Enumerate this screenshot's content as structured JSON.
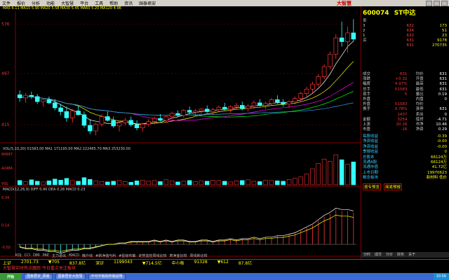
{
  "menu": {
    "items": [
      "文件",
      "报价",
      "分析",
      "功能",
      "大智慧",
      "平台",
      "工具",
      "帮助",
      "资讯",
      "国泰君安"
    ],
    "brand": "大智慧"
  },
  "info_bar": {
    "ma_line": "MA5 6.11 MA10 5.90 MA20 5.58 MA30 5.45 MA60 5.20 MA120 4.96"
  },
  "price_axis": {
    "labels": [
      "576",
      "497",
      "415"
    ]
  },
  "volume_axis": {
    "labels": [
      "84997",
      "42484",
      "VOL"
    ]
  },
  "macd_axis": {
    "labels": [
      "0.34",
      "0.14",
      "-0.02"
    ]
  },
  "vol_header": "VOL(5,10,20) 51583.00 MA1 171195.00 MA2 222465.70 MA3 253230.00",
  "macd_header": "MACD(12,26,9) DIFF 0.40 DEA 0.28 MACD 0.23",
  "indicator_tabs": [
    "KDJ",
    "CCI",
    "DMI",
    "PAE",
    "主力进出",
    "MACD",
    "散户线",
    "#新净值与利",
    "#星级布策",
    "走势监控周线比较",
    "寿净室比较",
    "周线新比较"
  ],
  "right_panel": {
    "code": "600074",
    "name": "ST中达",
    "orderbook": [
      {
        "label": "卖",
        "price": "",
        "vol": ""
      },
      {
        "label": "3",
        "price": "632",
        "vol": "173"
      },
      {
        "label": "2",
        "price": "634",
        "vol": "51"
      },
      {
        "label": "1",
        "price": "632",
        "vol": "23"
      },
      {
        "label": "买",
        "price": "631",
        "vol": "9178"
      },
      {
        "label": "",
        "price": "631",
        "vol": "270735"
      }
    ],
    "stats": [
      {
        "a": "成交",
        "av": "631",
        "b": "均价",
        "bv": "631"
      },
      {
        "a": "涨跌",
        "av": "+0.32",
        "b": "开盘",
        "bv": "631"
      },
      {
        "a": "幅度",
        "av": "4.97%",
        "b": "最高",
        "bv": "631"
      },
      {
        "a": "总手",
        "av": "51583",
        "b": "最低",
        "bv": "631"
      },
      {
        "a": "现手",
        "av": "5",
        "b": "量比",
        "bv": "0.19"
      },
      {
        "a": "外盘",
        "av": "",
        "b": "内盘",
        "bv": "0"
      },
      {
        "a": "外盘",
        "av": "51583",
        "b": "均价",
        "bv": ""
      },
      {
        "a": "换手",
        "av": "0.78%",
        "b": "涨停",
        "bv": "631"
      },
      {
        "a": "",
        "av": "1437",
        "b": "卖出",
        "bv": "0"
      },
      {
        "a": "金额",
        "av": "3254",
        "b": "借贷",
        "bv": "-4.71"
      },
      {
        "a": "上涨",
        "av": "20.16",
        "b": "市净",
        "bv": "10.46"
      },
      {
        "a": "市盈",
        "av": "-16",
        "b": "净资",
        "bv": "0.29"
      }
    ],
    "fin": [
      {
        "k": "每股收益",
        "v": "-0.39"
      },
      {
        "k": "净资收益",
        "v": "-0.00"
      },
      {
        "k": "净资收益",
        "v": "-0.00"
      },
      {
        "k": "季报收益",
        "v": "0"
      },
      {
        "k": "总股本",
        "v": "66124万"
      },
      {
        "k": "流通A股",
        "v": "66124万"
      },
      {
        "k": "流通市值",
        "v": "41.72亿"
      },
      {
        "k": "上市日期",
        "v": "19970623"
      },
      {
        "k": "概念板块",
        "v": "新材料   低价"
      }
    ],
    "links": [
      "按专预览",
      "简易预报"
    ],
    "bottom_tabs": [
      "分时",
      "成交",
      "分价",
      "财务",
      "关于"
    ]
  },
  "index_bar": {
    "row1": [
      "上证",
      "2701.73",
      "▼705",
      "837.8亿",
      "深证",
      "1199043",
      "▼714.5亿",
      "中小板",
      "91328",
      "▼612",
      "87.8亿"
    ],
    "row2": "大智慧实时热点跟踪 今日重点关注板块",
    "row3": [
      "270173",
      "▼705",
      "837.8亿"
    ]
  },
  "taskbar": {
    "start": "开始",
    "tasks": [
      "国泰君安_原版",
      "国泰君安大智慧",
      "不可不知的终端说明"
    ],
    "clock": "10:56"
  },
  "chart_data": {
    "type": "candlestick",
    "y_ticks": [
      576,
      497,
      415
    ],
    "candles": [
      {
        "o": 463,
        "h": 470,
        "l": 452,
        "c": 458
      },
      {
        "o": 458,
        "h": 466,
        "l": 450,
        "c": 462
      },
      {
        "o": 462,
        "h": 468,
        "l": 456,
        "c": 460
      },
      {
        "o": 460,
        "h": 464,
        "l": 448,
        "c": 452
      },
      {
        "o": 452,
        "h": 458,
        "l": 444,
        "c": 455
      },
      {
        "o": 455,
        "h": 460,
        "l": 448,
        "c": 450
      },
      {
        "o": 450,
        "h": 456,
        "l": 438,
        "c": 442
      },
      {
        "o": 442,
        "h": 448,
        "l": 430,
        "c": 436
      },
      {
        "o": 436,
        "h": 444,
        "l": 420,
        "c": 426
      },
      {
        "o": 426,
        "h": 440,
        "l": 418,
        "c": 437
      },
      {
        "o": 437,
        "h": 445,
        "l": 430,
        "c": 431
      },
      {
        "o": 431,
        "h": 436,
        "l": 410,
        "c": 414
      },
      {
        "o": 414,
        "h": 424,
        "l": 400,
        "c": 405
      },
      {
        "o": 405,
        "h": 418,
        "l": 398,
        "c": 416
      },
      {
        "o": 416,
        "h": 432,
        "l": 412,
        "c": 428
      },
      {
        "o": 428,
        "h": 436,
        "l": 420,
        "c": 422
      },
      {
        "o": 422,
        "h": 428,
        "l": 410,
        "c": 413
      },
      {
        "o": 413,
        "h": 420,
        "l": 404,
        "c": 418
      },
      {
        "o": 418,
        "h": 426,
        "l": 414,
        "c": 422
      },
      {
        "o": 422,
        "h": 428,
        "l": 412,
        "c": 415
      },
      {
        "o": 415,
        "h": 422,
        "l": 406,
        "c": 410
      },
      {
        "o": 410,
        "h": 418,
        "l": 404,
        "c": 416
      },
      {
        "o": 416,
        "h": 424,
        "l": 412,
        "c": 420
      },
      {
        "o": 420,
        "h": 428,
        "l": 416,
        "c": 425
      },
      {
        "o": 425,
        "h": 432,
        "l": 420,
        "c": 422
      },
      {
        "o": 422,
        "h": 430,
        "l": 418,
        "c": 428
      },
      {
        "o": 428,
        "h": 436,
        "l": 424,
        "c": 433
      },
      {
        "o": 433,
        "h": 438,
        "l": 428,
        "c": 430
      },
      {
        "o": 430,
        "h": 440,
        "l": 426,
        "c": 438
      },
      {
        "o": 438,
        "h": 444,
        "l": 432,
        "c": 435
      },
      {
        "o": 435,
        "h": 440,
        "l": 428,
        "c": 437
      },
      {
        "o": 437,
        "h": 442,
        "l": 432,
        "c": 440
      },
      {
        "o": 440,
        "h": 446,
        "l": 434,
        "c": 436
      },
      {
        "o": 436,
        "h": 442,
        "l": 430,
        "c": 439
      },
      {
        "o": 439,
        "h": 446,
        "l": 435,
        "c": 443
      },
      {
        "o": 443,
        "h": 450,
        "l": 438,
        "c": 440
      },
      {
        "o": 440,
        "h": 446,
        "l": 434,
        "c": 444
      },
      {
        "o": 444,
        "h": 450,
        "l": 440,
        "c": 446
      },
      {
        "o": 446,
        "h": 452,
        "l": 438,
        "c": 441
      },
      {
        "o": 441,
        "h": 448,
        "l": 436,
        "c": 445
      },
      {
        "o": 445,
        "h": 454,
        "l": 440,
        "c": 450
      },
      {
        "o": 450,
        "h": 456,
        "l": 444,
        "c": 446
      },
      {
        "o": 446,
        "h": 452,
        "l": 440,
        "c": 449
      },
      {
        "o": 449,
        "h": 458,
        "l": 446,
        "c": 455
      },
      {
        "o": 455,
        "h": 462,
        "l": 448,
        "c": 451
      },
      {
        "o": 451,
        "h": 456,
        "l": 444,
        "c": 448
      },
      {
        "o": 448,
        "h": 454,
        "l": 442,
        "c": 452
      },
      {
        "o": 452,
        "h": 460,
        "l": 448,
        "c": 457
      },
      {
        "o": 457,
        "h": 468,
        "l": 452,
        "c": 465
      },
      {
        "o": 465,
        "h": 476,
        "l": 460,
        "c": 472
      },
      {
        "o": 472,
        "h": 484,
        "l": 466,
        "c": 480
      },
      {
        "o": 480,
        "h": 496,
        "l": 476,
        "c": 492
      },
      {
        "o": 492,
        "h": 512,
        "l": 488,
        "c": 508
      },
      {
        "o": 508,
        "h": 532,
        "l": 504,
        "c": 528
      },
      {
        "o": 528,
        "h": 560,
        "l": 520,
        "c": 554
      },
      {
        "o": 554,
        "h": 580,
        "l": 540,
        "c": 548
      },
      {
        "o": 548,
        "h": 572,
        "l": 530,
        "c": 562
      },
      {
        "o": 562,
        "h": 584,
        "l": 548,
        "c": 552
      }
    ],
    "volume": [
      12,
      9,
      14,
      10,
      8,
      11,
      16,
      13,
      18,
      12,
      10,
      20,
      15,
      11,
      9,
      8,
      10,
      12,
      9,
      7,
      11,
      13,
      10,
      12,
      9,
      14,
      11,
      8,
      10,
      12,
      9,
      11,
      10,
      13,
      12,
      10,
      8,
      11,
      12,
      14,
      10,
      9,
      13,
      12,
      11,
      10,
      15,
      18,
      22,
      30,
      45,
      60,
      72,
      66,
      84,
      70,
      58,
      64
    ],
    "macd": [
      -0.02,
      -0.03,
      -0.03,
      -0.04,
      -0.04,
      -0.05,
      -0.05,
      -0.06,
      -0.05,
      -0.04,
      -0.04,
      -0.03,
      -0.03,
      -0.02,
      -0.01,
      0.0,
      0.0,
      0.01,
      0.01,
      0.02,
      0.02,
      0.02,
      0.02,
      0.03,
      0.02,
      0.03,
      0.02,
      0.03,
      0.03,
      0.02,
      0.02,
      0.03,
      0.03,
      0.02,
      0.03,
      0.03,
      0.04,
      0.03,
      0.04,
      0.04,
      0.05,
      0.04,
      0.05,
      0.05,
      0.06,
      0.06,
      0.07,
      0.08,
      0.1,
      0.12,
      0.14,
      0.17,
      0.2,
      0.22,
      0.25,
      0.24,
      0.24,
      0.23
    ]
  }
}
